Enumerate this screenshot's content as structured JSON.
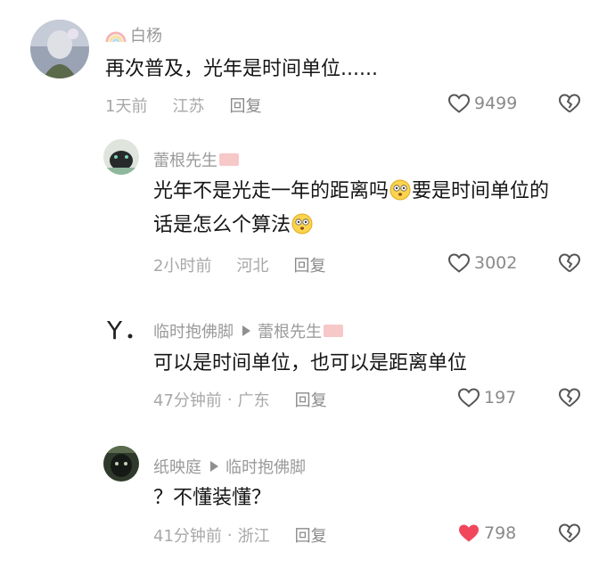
{
  "comments": [
    {
      "user": "白杨",
      "text": [
        "再次普及，光年是时间单位......"
      ],
      "time": "1天前",
      "location": "江苏",
      "reply_label": "回复",
      "likes": "9499",
      "liked": false
    },
    {
      "user": "蕾根先生",
      "text": [
        "光年不是光走一年的距离吗",
        "要是时间单位的",
        "话是怎么个算法"
      ],
      "time": "2小时前",
      "location": "河北",
      "reply_label": "回复",
      "likes": "3002",
      "liked": false
    },
    {
      "user": "临时抱佛脚",
      "reply_to": "蕾根先生",
      "text": [
        "可以是时间单位，也可以是距离单位"
      ],
      "time": "47分钟前",
      "location": "广东",
      "reply_label": "回复",
      "likes": "197",
      "liked": false
    },
    {
      "user": "纸映庭",
      "reply_to": "临时抱佛脚",
      "text": [
        "？不懂装懂？"
      ],
      "time": "41分钟前",
      "location": "浙江",
      "reply_label": "回复",
      "likes": "798",
      "liked": true
    }
  ],
  "icons": {
    "like": "heart-outline-icon",
    "liked": "heart-filled-icon",
    "dislike": "broken-heart-icon",
    "emoji": "flushed-face-emoji",
    "reply_arrow": "triangle-right-icon",
    "rainbow": "rainbow-icon"
  },
  "colors": {
    "liked_heart": "#f0475c",
    "secondary_text": "#a8a8a8",
    "username": "#9a9a9a",
    "body_text": "#161616"
  }
}
